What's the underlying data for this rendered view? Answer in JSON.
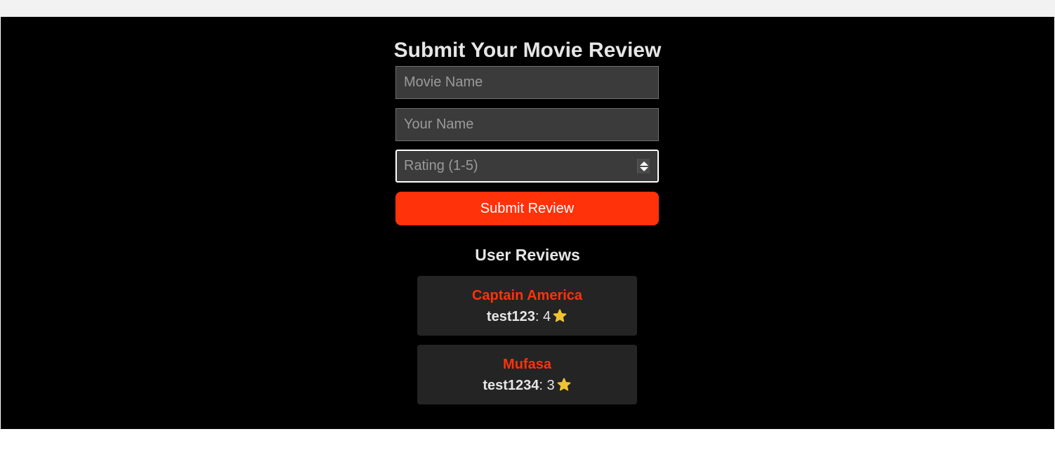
{
  "form": {
    "title": "Submit Your Movie Review",
    "movie_name_placeholder": "Movie Name",
    "your_name_placeholder": "Your Name",
    "rating_placeholder": "Rating (1-5)",
    "submit_label": "Submit Review"
  },
  "reviews": {
    "title": "User Reviews",
    "items": [
      {
        "movie": "Captain America",
        "user": "test123",
        "rating": "4",
        "rating_icon": "star-icon"
      },
      {
        "movie": "Mufasa",
        "user": "test1234",
        "rating": "3",
        "rating_icon": "star-icon"
      }
    ]
  },
  "colors": {
    "background": "#000000",
    "accent": "#ff3209",
    "card": "#242424",
    "input": "#3b3b3b",
    "star": "#f0c430",
    "text": "#e6e6e6"
  }
}
